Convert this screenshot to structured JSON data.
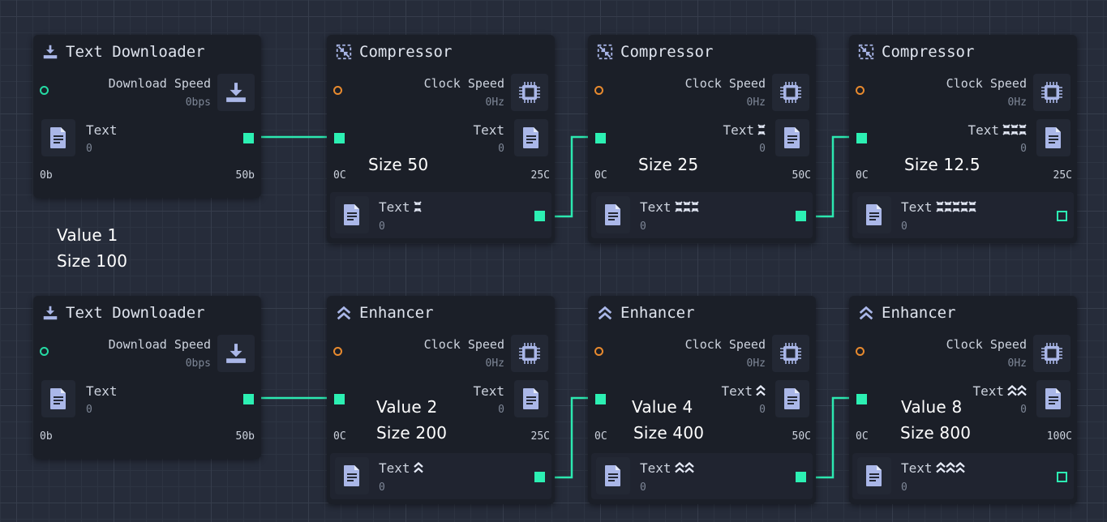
{
  "colors": {
    "accent": "#2cf0b3",
    "input_port_teal": "#25dba4",
    "input_port_orange": "#e88a2e",
    "node_bg": "#1b1f28",
    "wire": "#2ce8b0"
  },
  "icons": {
    "download": "download-icon",
    "compressor": "compress-icon",
    "enhancer": "chevrons-up-icon",
    "chip": "chip-icon",
    "document": "document-icon"
  },
  "downloaders": [
    {
      "title": "Text Downloader",
      "stat_label": "Download Speed",
      "stat_value": "0bps",
      "text_label": "Text",
      "text_value": "0",
      "left_value": "0b",
      "right_value": "50b"
    },
    {
      "title": "Text Downloader",
      "stat_label": "Download Speed",
      "stat_value": "0bps",
      "text_label": "Text",
      "text_value": "0",
      "left_value": "0b",
      "right_value": "50b"
    }
  ],
  "compressors": [
    {
      "title": "Compressor",
      "stat_label": "Clock Speed",
      "stat_value": "0Hz",
      "in_label": "Text",
      "in_value": "0",
      "in_level": 0,
      "left_value": "0C",
      "right_value": "25C",
      "out_label": "Text",
      "out_value": "0",
      "out_level": 1
    },
    {
      "title": "Compressor",
      "stat_label": "Clock Speed",
      "stat_value": "0Hz",
      "in_label": "Text",
      "in_value": "0",
      "in_level": 1,
      "left_value": "0C",
      "right_value": "50C",
      "out_label": "Text",
      "out_value": "0",
      "out_level": 3
    },
    {
      "title": "Compressor",
      "stat_label": "Clock Speed",
      "stat_value": "0Hz",
      "in_label": "Text",
      "in_value": "0",
      "in_level": 3,
      "left_value": "0C",
      "right_value": "25C",
      "out_label": "Text",
      "out_value": "0",
      "out_level": 5
    }
  ],
  "enhancers": [
    {
      "title": "Enhancer",
      "stat_label": "Clock Speed",
      "stat_value": "0Hz",
      "in_label": "Text",
      "in_value": "0",
      "in_level": 0,
      "left_value": "0C",
      "right_value": "25C",
      "out_label": "Text",
      "out_value": "0",
      "out_level": 1
    },
    {
      "title": "Enhancer",
      "stat_label": "Clock Speed",
      "stat_value": "0Hz",
      "in_label": "Text",
      "in_value": "0",
      "in_level": 1,
      "left_value": "0C",
      "right_value": "50C",
      "out_label": "Text",
      "out_value": "0",
      "out_level": 2
    },
    {
      "title": "Enhancer",
      "stat_label": "Clock Speed",
      "stat_value": "0Hz",
      "in_label": "Text",
      "in_value": "0",
      "in_level": 2,
      "left_value": "0C",
      "right_value": "100C",
      "out_label": "Text",
      "out_value": "0",
      "out_level": 3
    }
  ],
  "annotations": {
    "value_1": "Value 1",
    "size_100": "Size 100",
    "size_50": "Size 50",
    "size_25": "Size 25",
    "size_12_5": "Size 12.5",
    "value_2": "Value 2",
    "size_200": "Size 200",
    "value_4": "Value 4",
    "size_400": "Size 400",
    "value_8": "Value 8",
    "size_800": "Size 800"
  }
}
